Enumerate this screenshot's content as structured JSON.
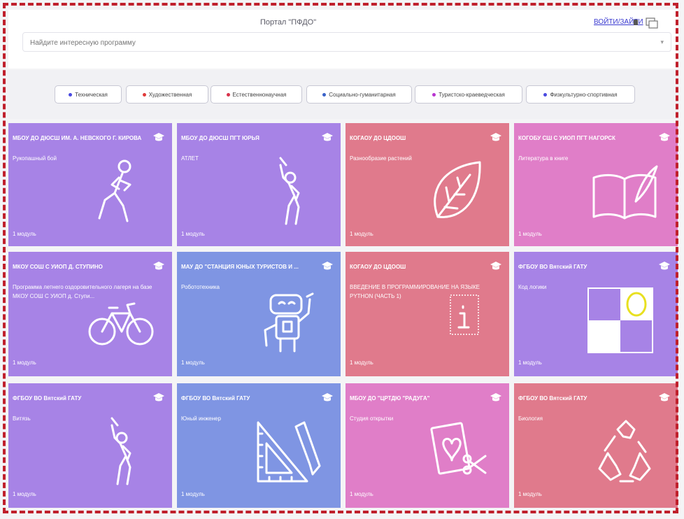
{
  "header": {
    "portal_title": "Портал \"ПФДО\"",
    "login_label": "ВОЙТИ/ЗАЙТИ",
    "search_placeholder": "Найдите интересную программу"
  },
  "filters": [
    {
      "label": "Техническая",
      "color": "#4a4ae0"
    },
    {
      "label": "Художественная",
      "color": "#e03a3a"
    },
    {
      "label": "Естественнонаучная",
      "color": "#d8324a"
    },
    {
      "label": "Социально-гуманитарная",
      "color": "#3a62c8"
    },
    {
      "label": "Туристско-краеведческая",
      "color": "#b834d0"
    },
    {
      "label": "Физкультурно-спортивная",
      "color": "#4a4ae0"
    }
  ],
  "cards": [
    {
      "org": "МБОУ ДО ДЮСШ ИМ. А. НЕВСКОГО Г. КИРОВА",
      "program": "Рукопашный бой",
      "modules": "1 модуль",
      "color": "#a783e6",
      "icon": "fighter-icon"
    },
    {
      "org": "МБОУ ДО ДЮСШ ПГТ ЮРЬЯ",
      "program": "АТЛЕТ",
      "modules": "1 модуль",
      "color": "#a783e6",
      "icon": "athlete-icon"
    },
    {
      "org": "КОГАОУ ДО ЦДООШ",
      "program": "Разнообразие растений",
      "modules": "1 модуль",
      "color": "#e07a8c",
      "icon": "leaf-icon"
    },
    {
      "org": "КОГОБУ СШ С УИОП ПГТ НАГОРСК",
      "program": "Литература в книге",
      "modules": "1 модуль",
      "color": "#e07ec8",
      "icon": "book-icon"
    },
    {
      "org": "МКОУ СОШ С УИОП Д. СТУПИНО",
      "program": "Программа летнего оздоровительного лагеря на базе МКОУ СОШ С УИОП д. Ступи...",
      "modules": "1 модуль",
      "color": "#a783e6",
      "icon": "bicycle-icon"
    },
    {
      "org": "МАУ ДО \"СТАНЦИЯ ЮНЫХ ТУРИСТОВ И ...",
      "program": "Робототехника",
      "modules": "1 модуль",
      "color": "#7f95e3",
      "icon": "robot-icon"
    },
    {
      "org": "КОГАОУ ДО ЦДООШ",
      "program": "ВВЕДЕНИЕ В ПРОГРАММИРОВАНИЕ НА ЯЗЫКЕ PYTHON (ЧАСТЬ 1)",
      "modules": "1 модуль",
      "color": "#e07a8c",
      "icon": "info-icon"
    },
    {
      "org": "ФГБОУ ВО Вятский ГАТУ",
      "program": "Код логики",
      "modules": "1 модуль",
      "color": "#a783e6",
      "icon": "logic-grid-icon"
    },
    {
      "org": "ФГБОУ ВО Вятский ГАТУ",
      "program": "Витязь",
      "modules": "1 модуль",
      "color": "#a783e6",
      "icon": "athlete-icon"
    },
    {
      "org": "ФГБОУ ВО Вятский ГАТУ",
      "program": "Юный инженер",
      "modules": "1 модуль",
      "color": "#7f95e3",
      "icon": "ruler-pencil-icon"
    },
    {
      "org": "МБОУ ДО \"ЦРТДЮ \"РАДУГА\"",
      "program": "Студия открытки",
      "modules": "1 модуль",
      "color": "#e07ec8",
      "icon": "card-scissors-icon"
    },
    {
      "org": "ФГБОУ ВО Вятский ГАТУ",
      "program": "Биология",
      "modules": "1 модуль",
      "color": "#e07a8c",
      "icon": "recycle-icon"
    }
  ]
}
